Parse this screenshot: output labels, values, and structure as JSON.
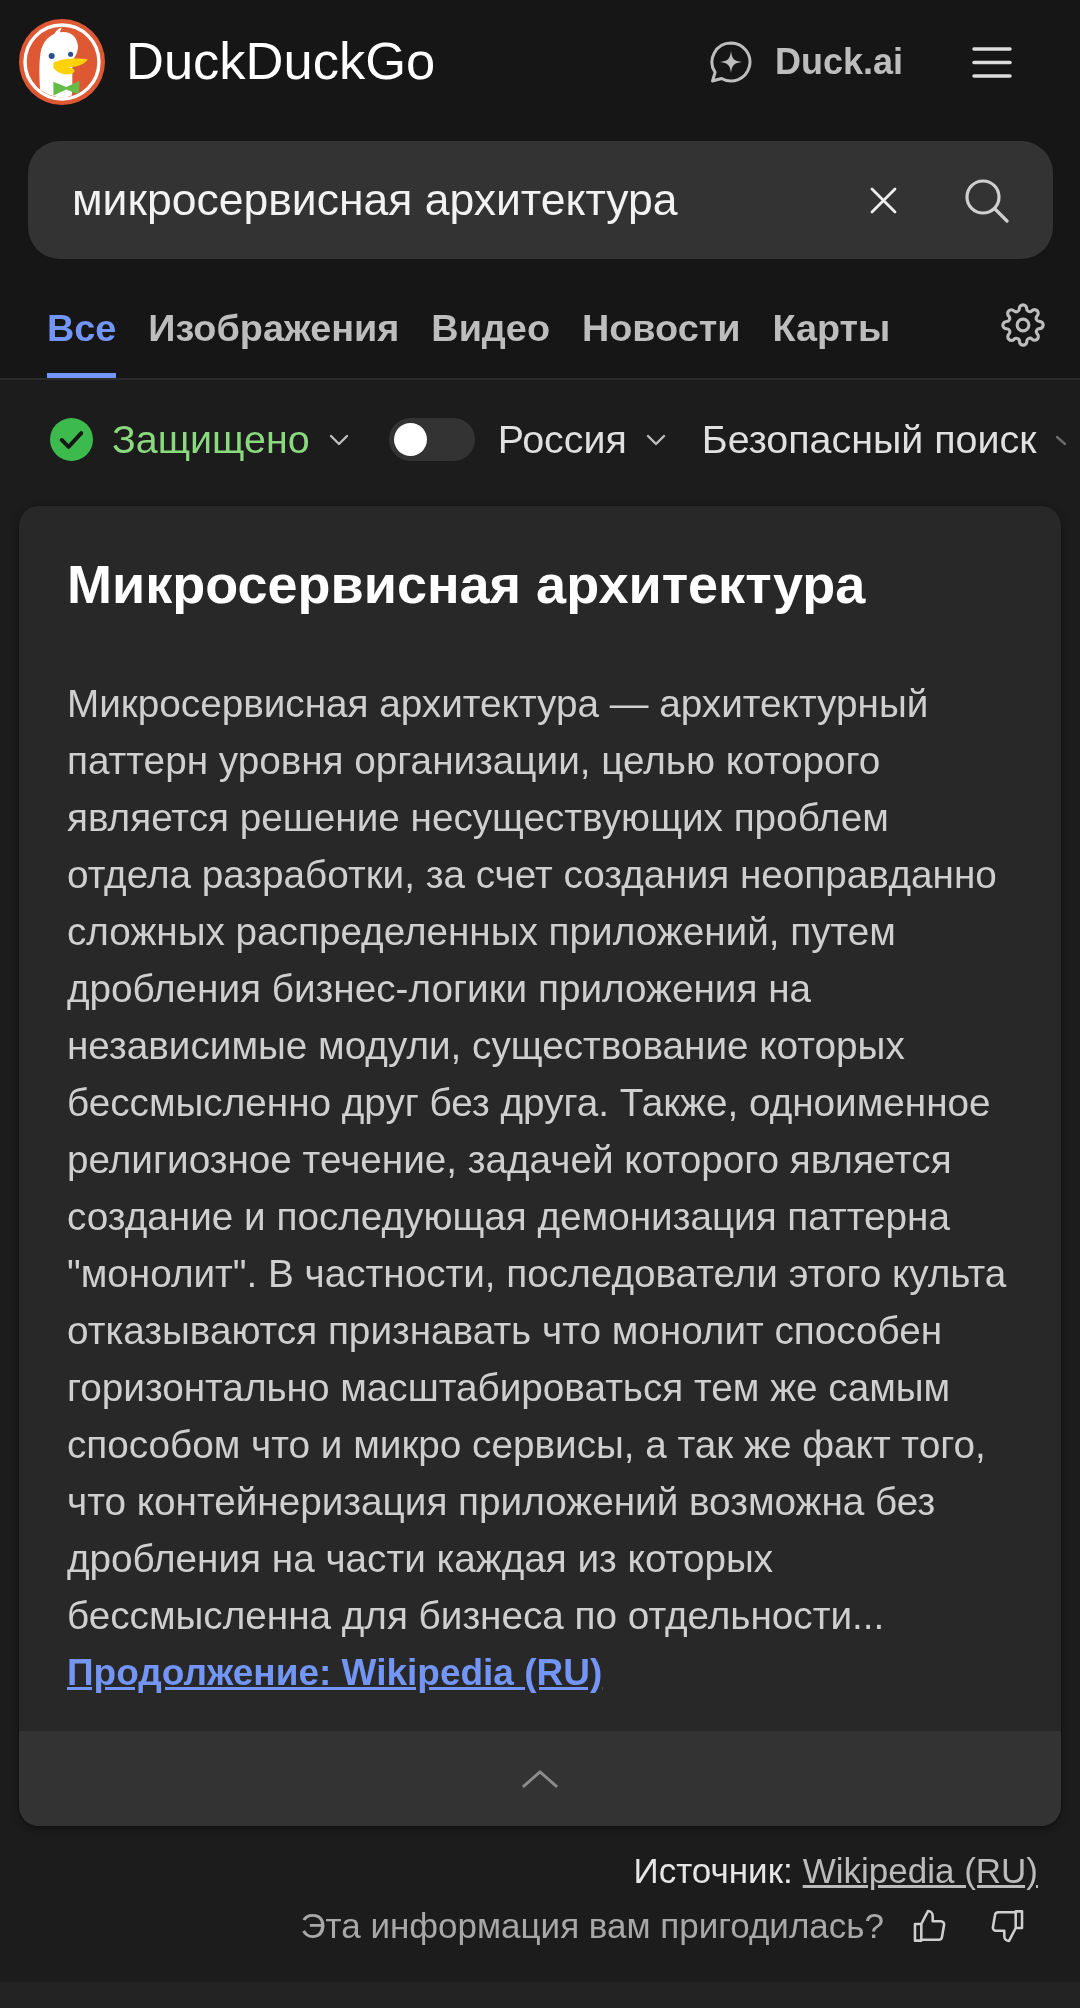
{
  "header": {
    "brand": "DuckDuckGo",
    "ai_link": "Duck.ai"
  },
  "search": {
    "value": "микросервисная архитектура"
  },
  "tabs": [
    {
      "label": "Все",
      "selected": true
    },
    {
      "label": "Изображения",
      "selected": false
    },
    {
      "label": "Видео",
      "selected": false
    },
    {
      "label": "Новости",
      "selected": false
    },
    {
      "label": "Карты",
      "selected": false
    }
  ],
  "filters": {
    "protection": {
      "label": "Защищено",
      "protected": true
    },
    "region": {
      "label": "Россия",
      "on": false
    },
    "safe_search": {
      "label": "Безопасный поиск"
    }
  },
  "card": {
    "title": "Микросервисная архитектура",
    "text": "Микросервисная архитектура — архитектурный паттерн уровня организации, целью которого является решение несуществующих проблем отдела разработки, за счет создания неоправданно сложных распределенных приложений, путем дробления бизнес-логики приложения на независимые модули, существование которых бессмысленно друг без друга. Также, одноименное религиозное течение, задачей которого является создание и последующая демонизация паттерна \"монолит\". В частности, последователи этого культа отказываются признавать что монолит способен горизонтально масштабироваться тем же самым способом что и микро сервисы, а так же факт того, что контейнеризация приложений возможна без дробления на части каждая из которых бессмысленна для бизнеса по отдельности...",
    "more_link": "Продолжение: Wikipedia (RU)",
    "expanded": true
  },
  "source": {
    "label": "Источник:",
    "link": "Wikipedia (RU)"
  },
  "feedback": {
    "question": "Эта информация вам пригодилась?"
  }
}
